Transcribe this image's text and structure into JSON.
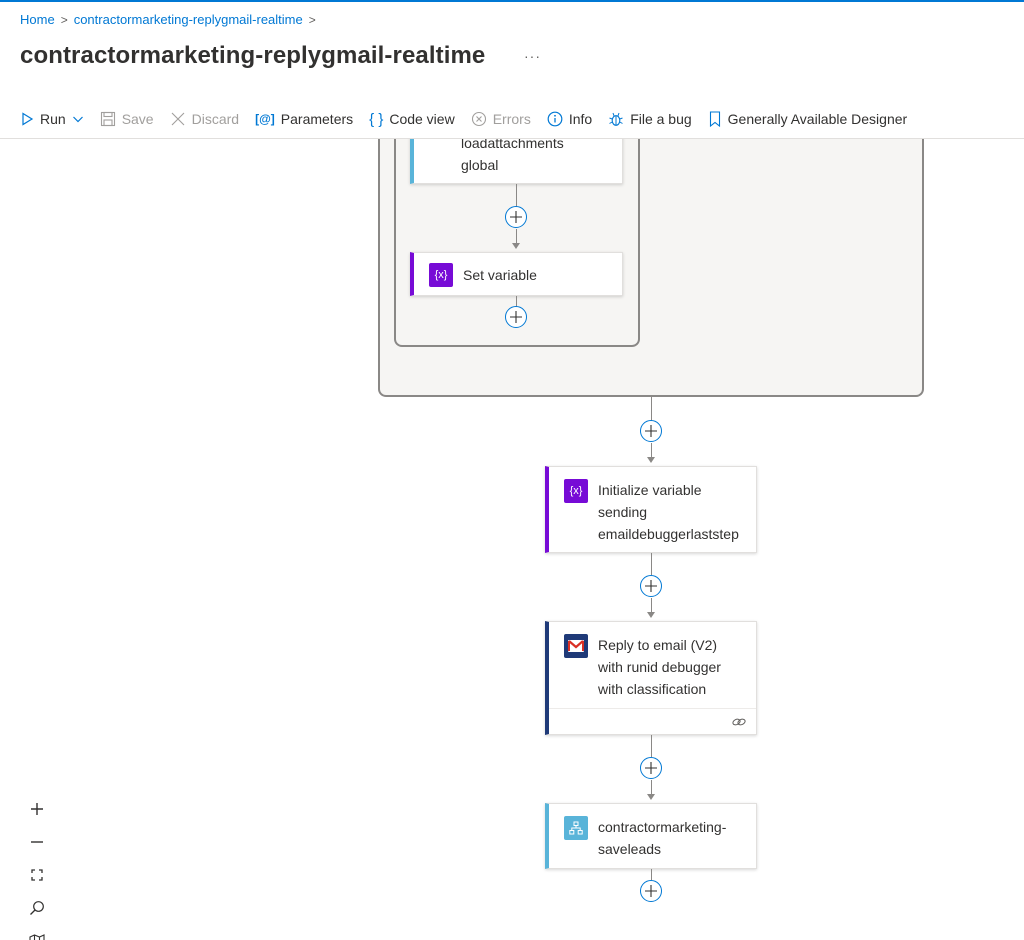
{
  "breadcrumb": {
    "home": "Home",
    "current": "contractormarketing-replygmail-realtime",
    "sep": ">"
  },
  "page": {
    "title": "contractormarketing-replygmail-realtime",
    "more": "···"
  },
  "toolbar": {
    "run": "Run",
    "save": "Save",
    "discard": "Discard",
    "parameters": "Parameters",
    "code_view": "Code view",
    "errors": "Errors",
    "info": "Info",
    "file_bug": "File a bug",
    "designer": "Generally Available Designer",
    "parameters_icon": "[@]",
    "code_icon": "{ }"
  },
  "cards": {
    "loadattachments": {
      "title": "loadattachments global",
      "line1": "loadattachments",
      "line2": "global",
      "accent": "#59b4d9"
    },
    "set_variable": {
      "title": "Set variable",
      "icon_text": "{x}",
      "accent": "#770bd6"
    },
    "init_variable": {
      "line1": "Initialize variable",
      "line2": "sending",
      "line3": "emaildebuggerlaststep",
      "icon_text": "{x}",
      "accent": "#770bd6"
    },
    "reply_email": {
      "line1": "Reply to email (V2)",
      "line2": "with runid debugger",
      "line3": "with classification",
      "accent": "#1f3a78",
      "icon": "gmail-icon",
      "link_icon": "link-icon"
    },
    "saveleads": {
      "line1": "contractormarketing-",
      "line2": "saveleads",
      "accent": "#59b4d9",
      "icon": "workflow-icon"
    }
  },
  "zoom": {
    "zoom_in": "+",
    "zoom_out": "−"
  },
  "colors": {
    "accent_blue": "#0078d4",
    "variable_purple": "#770bd6",
    "scope_bg": "#f6f5f3"
  }
}
